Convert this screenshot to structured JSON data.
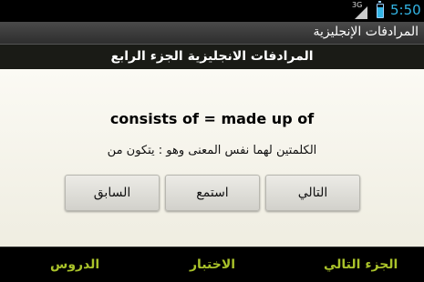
{
  "status_bar": {
    "network_type": "3G",
    "time": "5:50",
    "accent_color": "#33b5e5"
  },
  "app": {
    "title": "المرادفات الإنجليزية"
  },
  "header": {
    "section_title": "المرادفات الانجليزية الجزء الرابع"
  },
  "card": {
    "word_pair": "consists of = made up of",
    "meaning": "الكلمتين لهما نفس المعنى وهو : يتكون من"
  },
  "buttons": {
    "previous": "السابق",
    "listen": "استمع",
    "next": "التالي"
  },
  "bottom_nav": {
    "lessons": "الدروس",
    "test": "الاختبار",
    "next_part": "الجزء التالي",
    "color": "#a9c22a"
  },
  "icons": [
    "signal-icon",
    "battery-icon"
  ]
}
